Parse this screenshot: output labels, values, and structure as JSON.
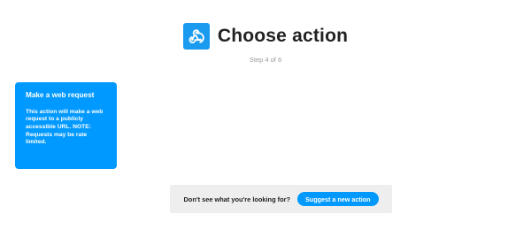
{
  "header": {
    "title": "Choose action",
    "icon": "webhooks-icon",
    "icon_color": "#1b9bf0",
    "step": "Step 4 of 6"
  },
  "action_card": {
    "title": "Make a web request",
    "description": "This action will make a web request to a publicly accessible URL. NOTE: Requests may be rate limited.",
    "color": "#0099ff"
  },
  "suggest": {
    "prompt": "Don't see what you're looking for?",
    "button_label": "Suggest a new action"
  }
}
